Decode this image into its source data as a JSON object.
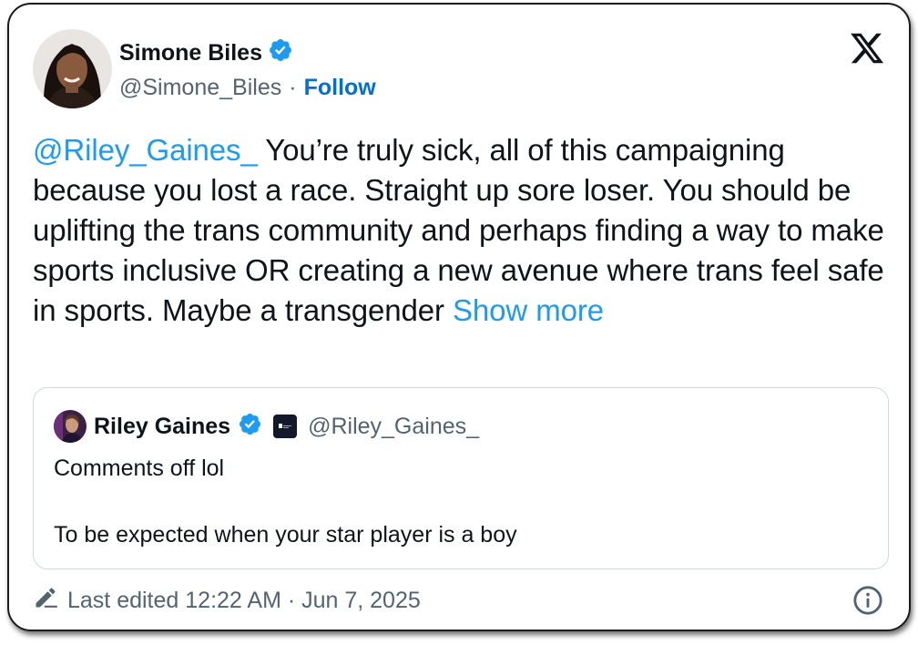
{
  "author": {
    "name": "Simone Biles",
    "handle": "@Simone_Biles",
    "separator": "·",
    "follow_label": "Follow"
  },
  "post": {
    "mention": "@Riley_Gaines_",
    "text": " You’re truly sick, all of this campaigning because you lost a race. Straight up sore loser. You should be uplifting the trans community and perhaps finding a way to make sports inclusive OR creating a new avenue where trans feel safe in sports. Maybe a transgender ",
    "show_more_label": "Show more"
  },
  "quoted_post": {
    "name": "Riley Gaines",
    "handle": "@Riley_Gaines_",
    "line1": "Comments off lol",
    "line2": "To be expected when your star player is a boy"
  },
  "footer": {
    "edited_text": "Last edited 12:22 AM · Jun 7, 2025"
  },
  "colors": {
    "link": "#1d9bf0",
    "follow": "#006fd6",
    "verified": "#1d9bf0",
    "secondary_text": "#536471"
  },
  "icons": [
    "verified-badge-icon",
    "x-logo-icon",
    "pencil-icon",
    "info-icon",
    "affiliate-badge-icon"
  ]
}
